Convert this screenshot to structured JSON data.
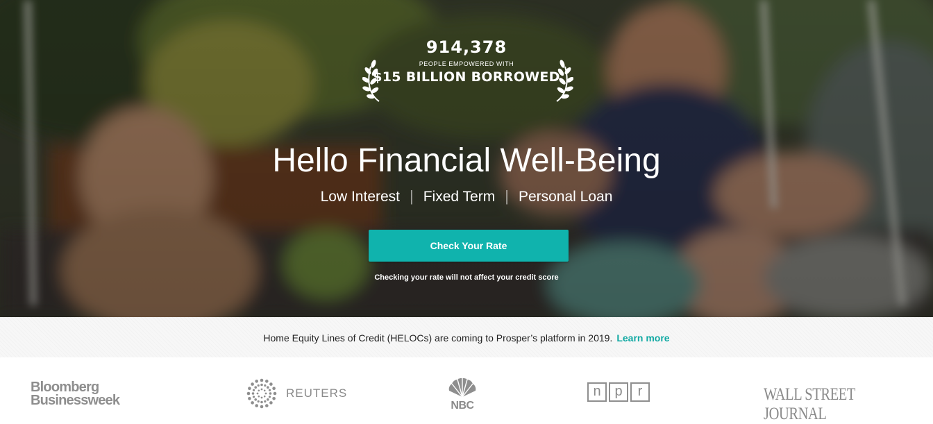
{
  "hero": {
    "stat_count": "914,378",
    "stat_sub": "PEOPLE EMPOWERED WITH",
    "stat_borrowed": "$15 BILLION BORROWED",
    "headline": "Hello Financial Well-Being",
    "taglines": [
      "Low Interest",
      "Fixed Term",
      "Personal Loan"
    ],
    "tagline_separator": "|",
    "cta_label": "Check Your Rate",
    "disclaimer": "Checking your rate will not affect your credit score"
  },
  "banner": {
    "text": "Home Equity Lines of Credit (HELOCs) are coming to Prosper’s platform in 2019.",
    "link": "Learn more"
  },
  "press": {
    "bloomberg_line1": "Bloomberg",
    "bloomberg_line2": "Businessweek",
    "reuters": "REUTERS",
    "nbc": "NBC",
    "npr_letters": [
      "n",
      "p",
      "r"
    ],
    "wsj": "WALL STREET JOURNAL"
  },
  "colors": {
    "accent": "#10b3ad",
    "link": "#10a9a3",
    "logo_gray": "#8e8e8e"
  }
}
